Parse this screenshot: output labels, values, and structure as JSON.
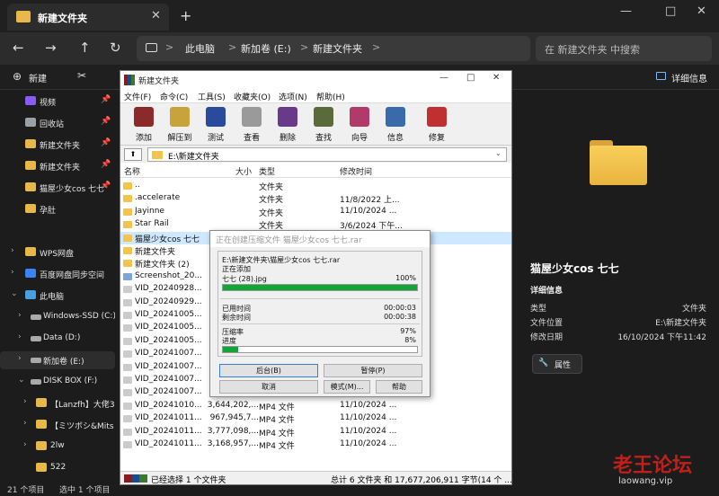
{
  "tabbar": {
    "tab_title": "新建文件夹",
    "new_tab": "+",
    "minimize": "—",
    "maximize": "□",
    "close": "✕",
    "tab_close": "✕"
  },
  "navbar": {
    "back": "←",
    "forward": "→",
    "up": "↑",
    "refresh": "↻",
    "more": "⋯",
    "breadcrumb": [
      "此电脑",
      "新加卷 (E:)",
      "新建文件夹"
    ],
    "sep": ">",
    "search_placeholder": "在 新建文件夹 中搜索"
  },
  "cmdbar": {
    "new_label": "新建",
    "details_label": "详细信息"
  },
  "sidebar": {
    "items": [
      {
        "label": "视频",
        "pin": "📌",
        "color": "#8a5cf5"
      },
      {
        "label": "回收站",
        "pin": "📌",
        "color": "#9aa0a6"
      },
      {
        "label": "新建文件夹",
        "pin": "📌",
        "color": "#e8b84a"
      },
      {
        "label": "新建文件夹",
        "pin": "📌",
        "color": "#e8b84a"
      },
      {
        "label": "猫屋少女cos 七七",
        "pin": "📌",
        "color": "#e8b84a"
      },
      {
        "label": "孕肚",
        "pin": "",
        "color": "#e8b84a"
      },
      {
        "label": "WPS网盘",
        "pin": "",
        "color": "#e8b84a"
      },
      {
        "label": "百度网盘同步空间",
        "pin": "",
        "color": "#3b82f6"
      },
      {
        "label": "此电脑",
        "pin": "",
        "color": "#4a9fe0"
      },
      {
        "label": "Windows-SSD (C:)",
        "pin": "",
        "color": "#aaaaaa"
      },
      {
        "label": "Data (D:)",
        "pin": "",
        "color": "#aaaaaa"
      },
      {
        "label": "新加卷 (E:)",
        "pin": "",
        "color": "#aaaaaa"
      },
      {
        "label": "DISK BOX (F:)",
        "pin": "",
        "color": "#aaaaaa"
      },
      {
        "label": "【Lanzfh】大佬3",
        "pin": "",
        "color": "#e8b84a"
      },
      {
        "label": "【ミツボシ&Mits",
        "pin": "",
        "color": "#e8b84a"
      },
      {
        "label": "2lw",
        "pin": "",
        "color": "#e8b84a"
      },
      {
        "label": "522",
        "pin": "",
        "color": "#e8b84a"
      }
    ]
  },
  "statusbar": {
    "count": "21 个项目",
    "selected": "选中 1 个项目"
  },
  "details_pane": {
    "title": "猫屋少女cos 七七",
    "section": "详细信息",
    "rows": [
      {
        "key": "类型",
        "value": "文件夹"
      },
      {
        "key": "文件位置",
        "value": "E:\\新建文件夹"
      },
      {
        "key": "修改日期",
        "value": "16/10/2024 下午11:42"
      }
    ],
    "properties_label": "属性"
  },
  "watermark": {
    "line1": "老王论坛",
    "line2": "laowang.vip"
  },
  "winrar": {
    "title": "新建文件夹",
    "menu": [
      "文件(F)",
      "命令(C)",
      "工具(S)",
      "收藏夹(O)",
      "选项(N)",
      "帮助(H)"
    ],
    "toolbar": [
      {
        "label": "添加",
        "color": "#8b2a2a"
      },
      {
        "label": "解压到",
        "color": "#c8a23a"
      },
      {
        "label": "测试",
        "color": "#2a4a9b"
      },
      {
        "label": "查看",
        "color": "#9a9a9a"
      },
      {
        "label": "删除",
        "color": "#6a3a8a"
      },
      {
        "label": "查找",
        "color": "#5a6a3a"
      },
      {
        "label": "向导",
        "color": "#b03a6a"
      },
      {
        "label": "信息",
        "color": "#3a6aaa"
      },
      {
        "label": "修复",
        "color": "#c03030"
      }
    ],
    "up_label": "⬆",
    "path": "E:\\新建文件夹",
    "columns": {
      "name": "名称",
      "size": "大小",
      "type": "类型",
      "date": "修改时间"
    },
    "rows": [
      {
        "name": "..",
        "size": "",
        "type": "文件夹",
        "date": "",
        "icon": "#f3c44b"
      },
      {
        "name": ".accelerate",
        "size": "",
        "type": "文件夹",
        "date": "11/8/2022 上...",
        "icon": "#f3c44b"
      },
      {
        "name": "Jayinne",
        "size": "",
        "type": "文件夹",
        "date": "11/10/2024 ...",
        "icon": "#f3c44b"
      },
      {
        "name": "Star Rail",
        "size": "",
        "type": "文件夹",
        "date": "3/6/2024 下午...",
        "icon": "#f3c44b"
      },
      {
        "name": "猫屋少女cos 七七",
        "size": "",
        "type": "",
        "date": "",
        "icon": "#f3c44b"
      },
      {
        "name": "新建文件夹",
        "size": "",
        "type": "",
        "date": "",
        "icon": "#f3c44b"
      },
      {
        "name": "新建文件夹 (2)",
        "size": "",
        "type": "",
        "date": "",
        "icon": "#f3c44b"
      },
      {
        "name": "Screenshot_20...",
        "size": "",
        "type": "",
        "date": "",
        "icon": "#7aa7d8"
      },
      {
        "name": "VID_20240928...",
        "size": "",
        "type": "",
        "date": "",
        "icon": "#cccccc"
      },
      {
        "name": "VID_20240929...",
        "size": "",
        "type": "",
        "date": "",
        "icon": "#cccccc"
      },
      {
        "name": "VID_20241005...",
        "size": "",
        "type": "",
        "date": "",
        "icon": "#cccccc"
      },
      {
        "name": "VID_20241005...",
        "size": "",
        "type": "",
        "date": "",
        "icon": "#cccccc"
      },
      {
        "name": "VID_20241005...",
        "size": "",
        "type": "",
        "date": "",
        "icon": "#cccccc"
      },
      {
        "name": "VID_20241007...",
        "size": "",
        "type": "",
        "date": "",
        "icon": "#cccccc"
      },
      {
        "name": "VID_20241007...",
        "size": "",
        "type": "",
        "date": "",
        "icon": "#cccccc"
      },
      {
        "name": "VID_20241007...",
        "size": "",
        "type": "",
        "date": "",
        "icon": "#cccccc"
      },
      {
        "name": "VID_20241007...",
        "size": "",
        "type": "",
        "date": "",
        "icon": "#cccccc"
      },
      {
        "name": "VID_20241010...",
        "size": "3,644,202,...",
        "type": "MP4 文件",
        "date": "11/10/2024 ...",
        "icon": "#cccccc"
      },
      {
        "name": "VID_20241011...",
        "size": "967,945,7...",
        "type": "MP4 文件",
        "date": "11/10/2024 ...",
        "icon": "#cccccc"
      },
      {
        "name": "VID_20241011...",
        "size": "3,777,098,...",
        "type": "MP4 文件",
        "date": "11/10/2024 ...",
        "icon": "#cccccc"
      },
      {
        "name": "VID_20241011...",
        "size": "3,168,957,...",
        "type": "MP4 文件",
        "date": "11/10/2024 ...",
        "icon": "#cccccc"
      }
    ],
    "status_left": "已经选择 1 个文件夹",
    "status_right": "总计 6 文件夹 和 17,677,206,911 字节(14 个 ..."
  },
  "progress_dialog": {
    "title": "正在创建压缩文件 猫屋少女cos 七七.rar",
    "file_path": "E:\\新建文件夹\\猫屋少女cos 七七.rar",
    "adding_label": "正在添加",
    "current_file": "七七 (28).jpg",
    "file_percent": "100%",
    "file_progress": 1.0,
    "elapsed_label": "已用时间",
    "elapsed": "00:00:03",
    "remaining_label": "剩余时间",
    "remaining": "00:00:38",
    "ratio_label": "压缩率",
    "ratio": "97%",
    "progress_label": "进度",
    "progress": "8%",
    "total_progress": 0.08,
    "buttons": {
      "background": "后台(B)",
      "pause": "暂停(P)",
      "cancel": "取消",
      "mode": "模式(M)...",
      "help": "帮助"
    }
  }
}
